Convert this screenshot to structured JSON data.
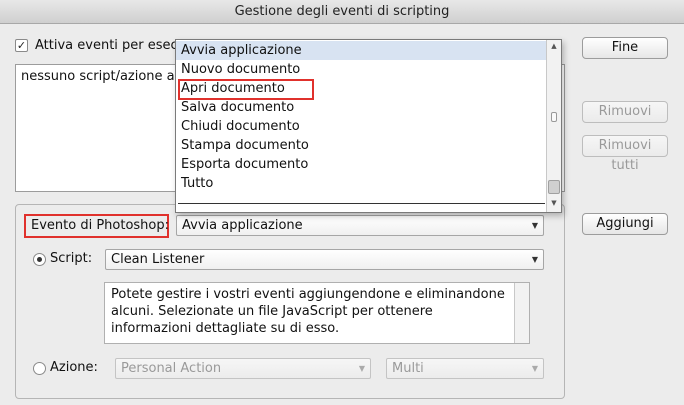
{
  "window": {
    "title": "Gestione degli eventi di scripting"
  },
  "enable_events": {
    "label": "Attiva eventi per esecu",
    "checked": true
  },
  "events_list": {
    "items": [
      "nessuno script/azione as"
    ]
  },
  "buttons": {
    "done": "Fine",
    "remove": "Rimuovi",
    "remove_all": "Rimuovi tutti",
    "add": "Aggiungi"
  },
  "dropdown_menu": {
    "items": [
      "Avvia applicazione",
      "Nuovo documento",
      "Apri documento",
      "Salva documento",
      "Chiudi documento",
      "Stampa documento",
      "Esporta documento",
      "Tutto"
    ],
    "selected_index": 0,
    "highlighted_index": 2
  },
  "photoshop_event": {
    "label": "Evento di Photoshop:",
    "value": "Avvia applicazione"
  },
  "script": {
    "label": "Script:",
    "value": "Clean Listener",
    "selected": true
  },
  "description": {
    "text": "Potete gestire i vostri eventi aggiungendone e eliminandone alcuni. Selezionate un file JavaScript per ottenere informazioni dettagliate su di esso."
  },
  "action": {
    "label": "Azione:",
    "set_value": "Personal Action",
    "action_value": "Multi",
    "selected": false
  },
  "colors": {
    "highlight": "#e0312c",
    "selected_row": "#d8e3f2"
  }
}
